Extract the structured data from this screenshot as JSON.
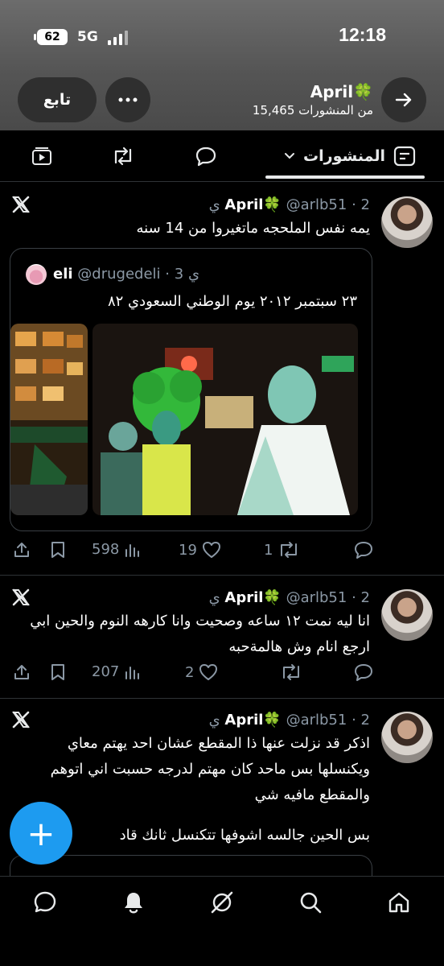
{
  "status_bar": {
    "battery": "62",
    "network": "5G",
    "time": "12:18"
  },
  "profile_header": {
    "follow_label": "تابع",
    "name": "April🍀",
    "posts_count": "15,465 من المنشورات"
  },
  "tabs": {
    "posts_label": "المنشورات"
  },
  "posts": [
    {
      "name": "April🍀",
      "handle": "@arlb51",
      "time": "2 ي",
      "text": "يمه نفس الملحجه ماتغيروا من 14 سنه",
      "quote": {
        "name": "eli",
        "handle": "@drugedeli",
        "time": "3 ي",
        "text": "٢٣ سبتمبر ٢٠١٢ يوم الوطني السعودي ٨٢"
      },
      "views": "598",
      "likes": "19",
      "reposts": "1"
    },
    {
      "name": "April🍀",
      "handle": "@arlb51",
      "time": "2 ي",
      "text": "انا ليه نمت ١٢ ساعه وصحيت وانا كارهه النوم والحين ابي ارجع انام وش هالمةحبه",
      "views": "207",
      "likes": "2",
      "reposts": ""
    },
    {
      "name": "April🍀",
      "handle": "@arlb51",
      "time": "2 ي",
      "text": "اذكر قد نزلت عنها ذا المقطع عشان احد يهتم معاي ويكنسلها بس ماحد كان مهتم لدرجه حسبت اني اتوهم والمقطع مافيه شي",
      "text2": "بس الحين جالسه اشوفها تتكنسل ثانك قاد"
    }
  ],
  "fab": {
    "label": "+"
  },
  "colors": {
    "accent": "#1d9bf0",
    "muted": "#8b98a5",
    "divider": "#2f3336"
  }
}
